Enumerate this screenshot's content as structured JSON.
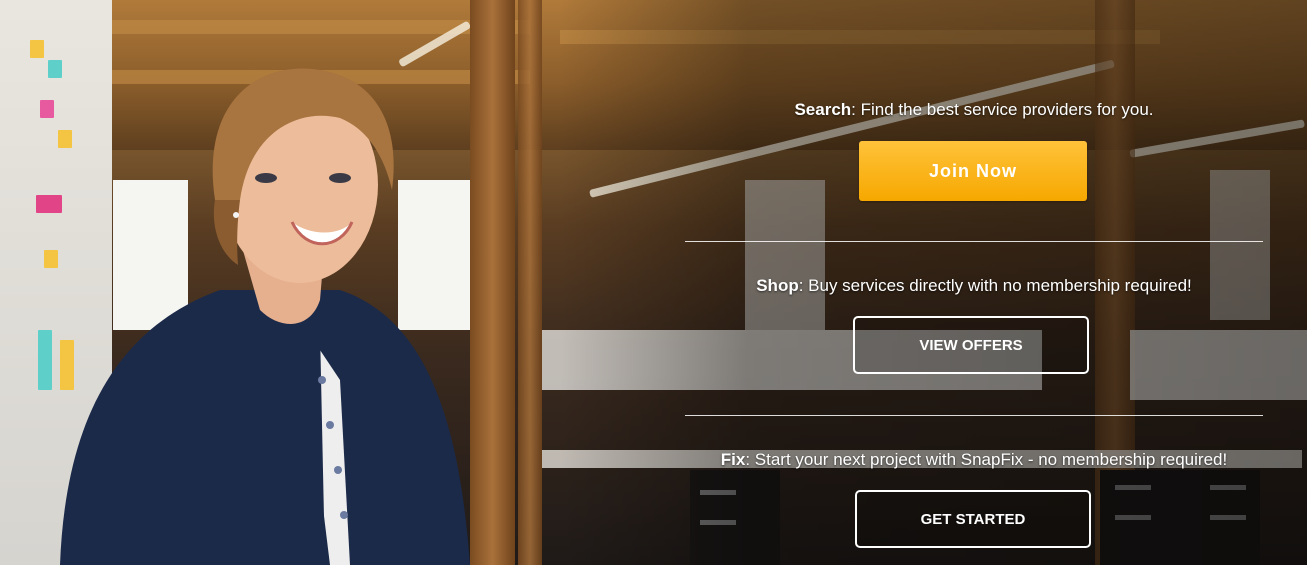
{
  "sections": {
    "search": {
      "label": "Search",
      "text": ": Find the best service providers for you.",
      "button": "Join Now"
    },
    "shop": {
      "label": "Shop",
      "text": ": Buy services directly with no membership required!",
      "button": "VIEW OFFERS"
    },
    "fix": {
      "label": "Fix",
      "text": ": Start your next project with SnapFix - no membership required!",
      "button": "GET STARTED"
    }
  },
  "colors": {
    "primary_button": "#f6a800",
    "text": "#ffffff"
  },
  "hero_image": "office-background-with-smiling-woman"
}
